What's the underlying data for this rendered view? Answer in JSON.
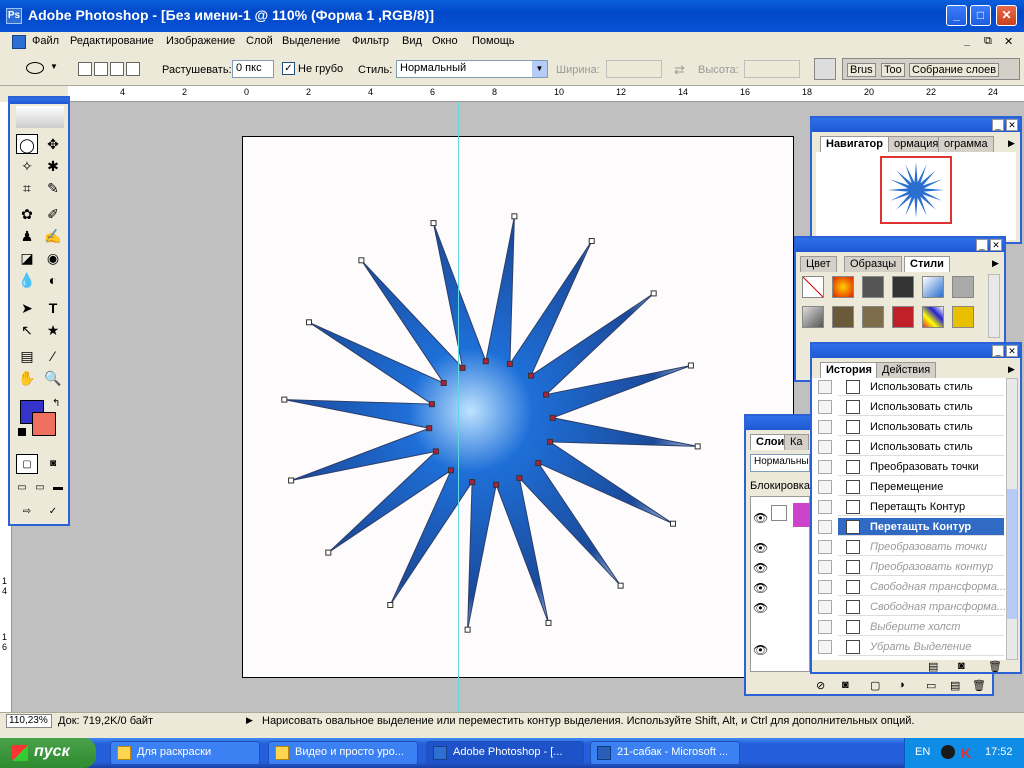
{
  "app": {
    "title": "Adobe Photoshop - [Без имени-1 @ 110% (Форма 1 ,RGB/8)]",
    "icon_name": "photoshop-app-icon"
  },
  "window_buttons": {
    "minimize": "_",
    "maximize": "□",
    "close": "✕",
    "doc_minimize": "_",
    "doc_restore": "⧉",
    "doc_close": "✕"
  },
  "menu": [
    "Файл",
    "Редактирование",
    "Изображение",
    "Слой",
    "Выделение",
    "Фильтр",
    "Вид",
    "Окно",
    "Помощь"
  ],
  "options": {
    "feather_label": "Растушевать:",
    "feather_value": "0 пкс",
    "antialias_label": "Не грубо",
    "style_label": "Стиль:",
    "style_value": "Нормальный",
    "width_label": "Ширина:",
    "height_label": "Высота:",
    "palette_tabs": [
      "Brus",
      "Too",
      "Собрание слоев"
    ]
  },
  "ruler_top": [
    "4",
    "2",
    "0",
    "2",
    "4",
    "6",
    "8",
    "10",
    "12",
    "14",
    "16",
    "18",
    "20",
    "22",
    "24"
  ],
  "ruler_left": [
    "1",
    "4",
    "1",
    "6"
  ],
  "navigator": {
    "tabs": [
      "Навигатор",
      "ормация",
      "ограмма"
    ]
  },
  "color_panel": {
    "tabs": [
      "Цвет",
      "Образцы",
      "Стили"
    ]
  },
  "layers_panel": {
    "tabs": [
      "Слои",
      "Ка"
    ],
    "blend_mode": "Нормальны",
    "lock_label": "Блокировка"
  },
  "history": {
    "tabs": [
      "История",
      "Действия"
    ],
    "items": [
      {
        "label": "Использовать стиль",
        "state": "normal"
      },
      {
        "label": "Использовать стиль",
        "state": "normal"
      },
      {
        "label": "Использовать стиль",
        "state": "normal"
      },
      {
        "label": "Использовать стиль",
        "state": "normal"
      },
      {
        "label": "Преобразовать точки",
        "state": "normal"
      },
      {
        "label": "Перемещение",
        "state": "normal"
      },
      {
        "label": "Перетащть Контур",
        "state": "normal"
      },
      {
        "label": "Перетащть Контур",
        "state": "selected"
      },
      {
        "label": "Преобразовать точки",
        "state": "dim"
      },
      {
        "label": "Преобразовать контур",
        "state": "dim"
      },
      {
        "label": "Свободная трансформа...",
        "state": "dim"
      },
      {
        "label": "Свободная трансформа...",
        "state": "dim"
      },
      {
        "label": "Выберите холст",
        "state": "dim"
      },
      {
        "label": "Убрать Выделение",
        "state": "dim"
      }
    ]
  },
  "status": {
    "zoom": "110,23%",
    "doc": "Док: 719,2K/0 байт",
    "hint": "Нарисовать овальное выделение или переместить контур выделения. Используйте Shift, Alt, и Ctrl для дополнительных опций."
  },
  "taskbar": {
    "start": "пуск",
    "tasks": [
      "Для раскраски",
      "Видео и просто уро...",
      "Adobe Photoshop - [...",
      "21-сабак - Microsoft ..."
    ],
    "lang": "EN",
    "time": "17:52"
  },
  "colors": {
    "foreground": "#3434c8",
    "background": "#f07060",
    "accent": "#2b62d6",
    "star_fill": "#1e6fd8"
  }
}
